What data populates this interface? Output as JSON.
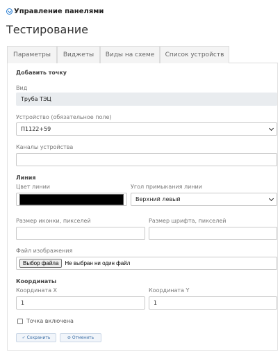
{
  "header": {
    "back_link": "Управление панелями",
    "page_title": "Тестирование"
  },
  "tabs": [
    {
      "label": "Параметры"
    },
    {
      "label": "Виджеты"
    },
    {
      "label": "Виды на схеме"
    },
    {
      "label": "Список устройств"
    }
  ],
  "form": {
    "section_add": "Добавить точку",
    "view": {
      "label": "Вид",
      "value": "Труба ТЭЦ"
    },
    "device": {
      "label": "Устройство (обязательное поле)",
      "value": "П1122+59"
    },
    "channels": {
      "label": "Каналы устройства",
      "value": ""
    },
    "line": {
      "section": "Линия",
      "color_label": "Цвет линии",
      "color_value": "#000000",
      "angle_label": "Угол примыкания линии",
      "angle_value": "Верхний левый"
    },
    "icon_size": {
      "label": "Размер иконки, пикселей",
      "value": ""
    },
    "font_size": {
      "label": "Размер шрифта, пикселей",
      "value": ""
    },
    "image_file": {
      "label": "Файл изображения",
      "button": "Выбор файла",
      "status": "Не выбран ни один файл"
    },
    "coords": {
      "section": "Координаты",
      "x_label": "Координата X",
      "x_value": "1",
      "y_label": "Координата Y",
      "y_value": "1"
    },
    "enabled": {
      "label": "Точка включена",
      "checked": false
    }
  },
  "actions": {
    "save": "Сохранить",
    "cancel": "Отменить"
  }
}
